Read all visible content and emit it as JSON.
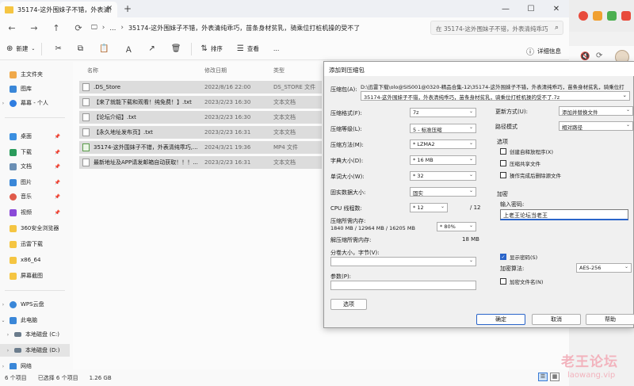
{
  "explorer": {
    "tab_title": "35174-这外围妹子不错，外表清纯乖巧，苗条身材贫乳，骑乘位打桩机操的受不了",
    "tab_close": "✕",
    "new_tab": "+",
    "window_buttons": [
      "—",
      "☐",
      "✕"
    ],
    "nav": {
      "back": "←",
      "forward": "→",
      "up": "↑",
      "refresh": "⟳",
      "monitor": "🖵",
      "more": "…"
    },
    "path_sep": "›",
    "path_text": "35174-这外围妹子不错，外表清纯乖巧，苗条身材贫乳，骑乘位打桩机操的受不了",
    "search_placeholder": "在 35174-这外围妹子不错，外表清纯乖巧",
    "search_glyph": "⌕",
    "toolbar": {
      "new_label": "新建",
      "new_glyph": "⊕",
      "cut_glyph": "✂",
      "copy_glyph": "⧉",
      "paste_glyph": "📋",
      "rename_glyph": "Ａ",
      "share_glyph": "↗",
      "delete_glyph": "🗑",
      "sort_label": "排序",
      "sort_glyph": "⇅",
      "view_label": "查看",
      "view_glyph": "☰",
      "more_glyph": "…",
      "detail_label": "详细信息",
      "detail_glyph": "ⓘ"
    },
    "sidebar": [
      {
        "label": "主文件夹",
        "color": "#f0a94a"
      },
      {
        "label": "图库",
        "color": "#3a87d8"
      },
      {
        "label": "幕幕 - 个人",
        "color": "#2f7de0"
      },
      {
        "label": "桌面",
        "color": "#3b8fe0"
      },
      {
        "label": "下载",
        "color": "#2a9b5b"
      },
      {
        "label": "文档",
        "color": "#6b8fb4"
      },
      {
        "label": "图片",
        "color": "#3a87d8"
      },
      {
        "label": "音乐",
        "color": "#e05a4a"
      },
      {
        "label": "视频",
        "color": "#8a4ad8"
      },
      {
        "label": "360安全浏览器",
        "color": "#f5c542"
      },
      {
        "label": "迅雷下载",
        "color": "#f5c542"
      },
      {
        "label": "x86_64",
        "color": "#f5c542"
      },
      {
        "label": "屏幕截图",
        "color": "#f5c542"
      },
      {
        "label": "WPS云盘",
        "color": "#3a87d8"
      },
      {
        "label": "此电脑",
        "color": "#3a87d8"
      },
      {
        "label": "本地磁盘 (C:)",
        "color": "#6b7c8c"
      },
      {
        "label": "本地磁盘 (D:)",
        "color": "#6b7c8c"
      },
      {
        "label": "网络",
        "color": "#3a87d8"
      }
    ],
    "columns": {
      "name": "名称",
      "date": "修改日期",
      "type": "类型"
    },
    "files": [
      {
        "name": ".DS_Store",
        "date": "2022/8/16 22:00",
        "type": "DS_STORE 文件"
      },
      {
        "name": "【来了就能下载和观看！纯免费！】.txt",
        "date": "2023/2/23 16:30",
        "type": "文本文档"
      },
      {
        "name": "【论坛介绍】.txt",
        "date": "2023/2/23 16:30",
        "type": "文本文档"
      },
      {
        "name": "【永久地址发布页】.txt",
        "date": "2023/2/23 16:31",
        "type": "文本文档"
      },
      {
        "name": "35174-这外围妹子不错，外表清纯乖巧,...",
        "date": "2024/3/21 19:36",
        "type": "MP4 文件"
      },
      {
        "name": "最新地址及APP请发邮箱自动获取！！！...",
        "date": "2023/2/23 16:31",
        "type": "文本文档"
      }
    ],
    "status": {
      "count": "6 个项目",
      "selected": "已选择 6 个项目",
      "size": "1.26 GB"
    }
  },
  "watermark": {
    "main": "老王论坛",
    "sub": "laowang.vip"
  },
  "dialog": {
    "title": "添加到压缩包",
    "archive_label": "压缩包(A):",
    "archive_dir": "D:\\迅雷下载\\olo@SIS001@0320-精品合集-12\\35174-这外围妹子不错，外表清纯乖巧，苗条身材贫乳，骑乘位打",
    "archive_name": "35174-这外围妹子不错，外表清纯乖巧，苗条身材贫乳，骑乘位打桩机操的受不了.7z",
    "format_label": "压缩格式(F):",
    "format_value": "7z",
    "level_label": "压缩等级(L):",
    "level_value": "5 - 标准压缩",
    "method_label": "压缩方法(M):",
    "method_value": "* LZMA2",
    "dict_label": "字典大小(D):",
    "dict_value": "* 16 MB",
    "word_label": "单词大小(W):",
    "word_value": "* 32",
    "solid_label": "固实数据大小:",
    "solid_value": "固实",
    "threads_label": "CPU 线程数:",
    "threads_value": "* 12",
    "threads_max": "/ 12",
    "mem_label": "压缩所需内存:",
    "mem_value": "1840 MB / 12964 MB / 16205 MB",
    "mem_percent": "* 80%",
    "decomp_label": "解压缩所需内存:",
    "decomp_value": "18 MB",
    "split_label": "分卷大小，字节(V):",
    "params_label": "参数(P):",
    "options_button": "选项",
    "update_label": "更新方式(U):",
    "update_value": "添加并替换文件",
    "path_label": "路径模式",
    "path_value": "相对路径",
    "options_group": "选项",
    "opt_sfx": "创建自释放程序(X)",
    "opt_shared": "压缩共享文件",
    "opt_delete": "操作完成后删除源文件",
    "encrypt_group": "加密",
    "password_label": "输入密码:",
    "password_value": "上老王论坛当老王",
    "show_password": "显示密码(S)",
    "enc_method_label": "加密算法:",
    "enc_method_value": "AES-256",
    "enc_names": "加密文件名(N)",
    "ok_button": "确定",
    "cancel_button": "取消",
    "help_button": "帮助",
    "dropdown_glyph": "⌄",
    "check_glyph": "✓"
  }
}
